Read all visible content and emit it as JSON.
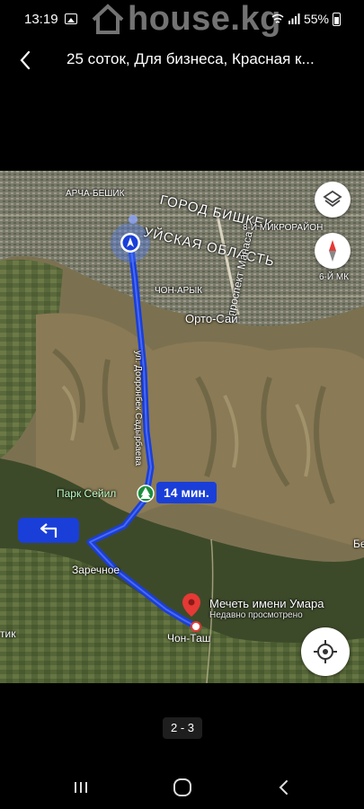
{
  "status": {
    "time": "13:19",
    "watermark": "house.kg",
    "battery": "55%"
  },
  "header": {
    "title": "25 соток, Для бизнеса, Красная к..."
  },
  "map": {
    "labels": {
      "city": "ГОРОД БИШКЕК",
      "region": "УЙСКАЯ ОБЛАСТЬ",
      "archa_beshik": "АРЧА-БЕШИК",
      "chon_aryk": "ЧОН-АРЫК",
      "micro8": "8-Й МИКРОРАЙОН",
      "micro6": "6-Й МК",
      "prospect": "проспект Манаса",
      "orto_sai": "Орто-Сай",
      "street": "ул. Дооронбек Садырбаева",
      "park": "Парк Сейил",
      "zarechnoe": "Заречное",
      "chon_tash": "Чон-Таш",
      "left_edge": "тик",
      "right_edge": "Бе"
    },
    "eta": "14 мин.",
    "destination": {
      "name": "Мечеть имени Умара",
      "subtitle": "Недавно просмотрено"
    },
    "colors": {
      "route": "#1a3fd8",
      "pin": "#e53935"
    }
  },
  "pager": {
    "text": "2 - 3"
  }
}
